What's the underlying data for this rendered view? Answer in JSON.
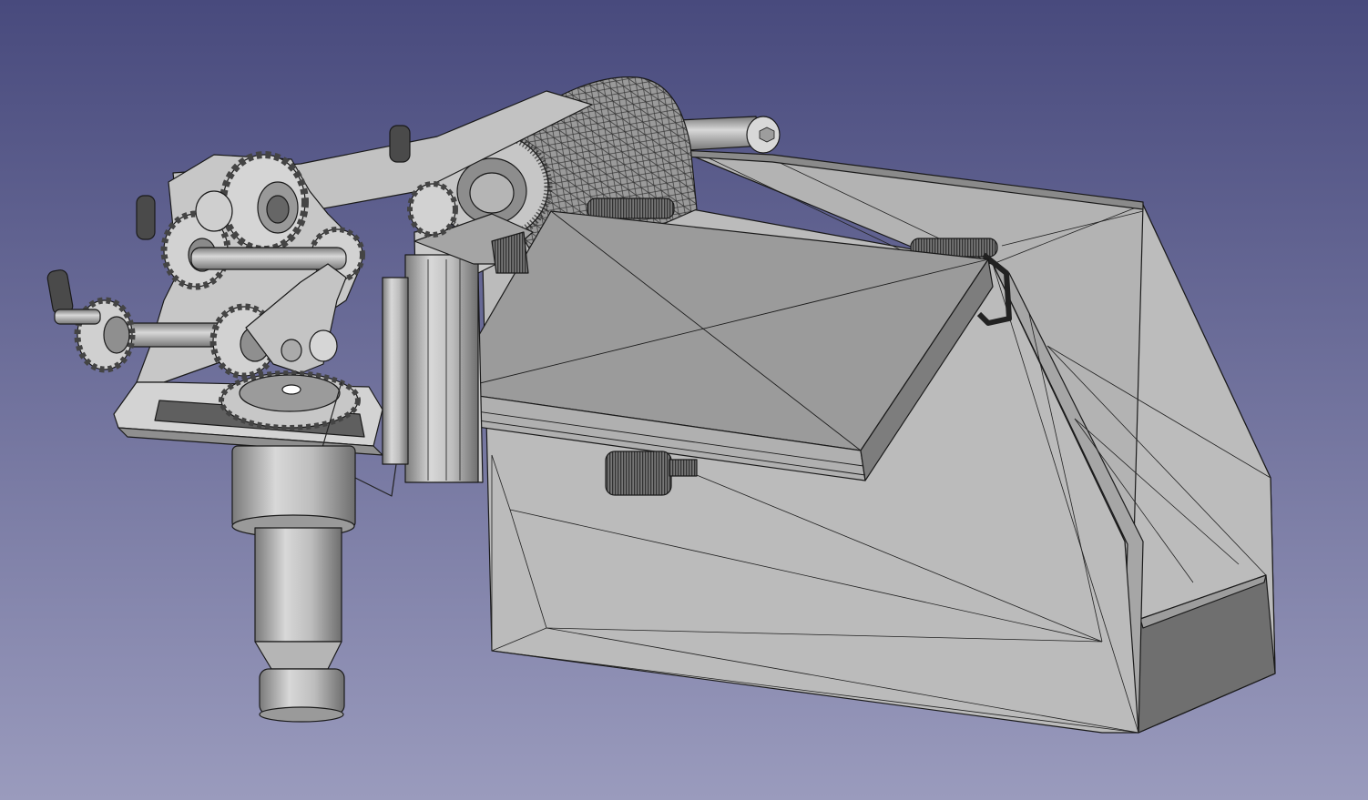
{
  "app": {
    "view": "3d-viewport",
    "background": {
      "top": "#484a7d",
      "bottom": "#9a9bbd"
    },
    "model": {
      "base_color": "#b9b9b9",
      "light_color": "#d2d2d2",
      "mid_color": "#8f8f8f",
      "dark_color": "#5e5e5e",
      "edge_color": "#1a1a1a"
    }
  }
}
